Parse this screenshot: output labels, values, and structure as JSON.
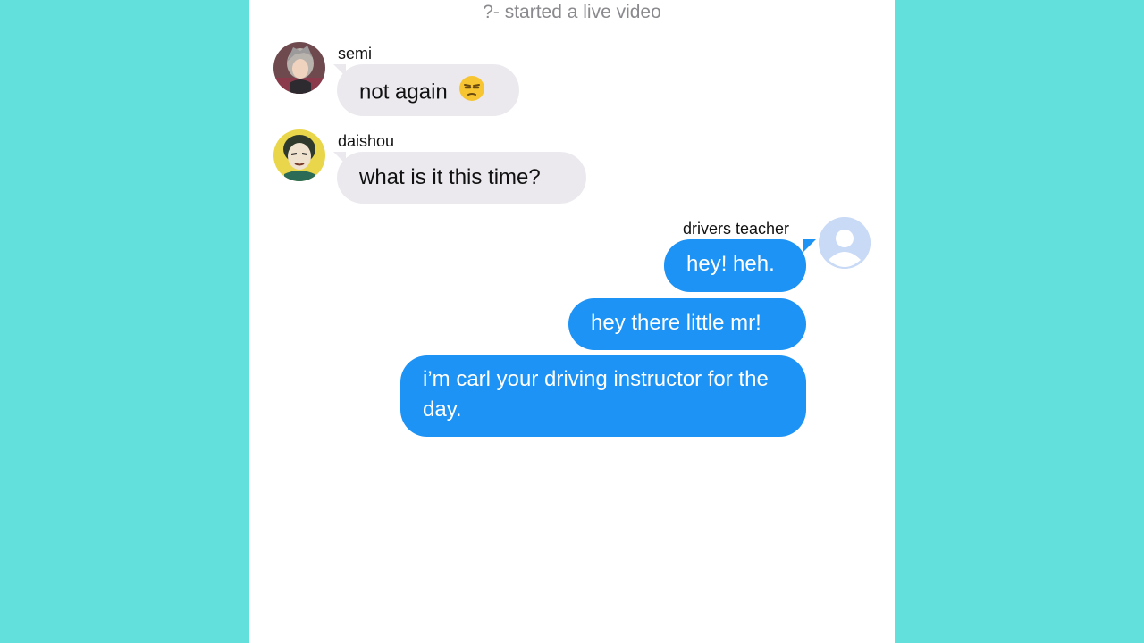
{
  "system_message": "?- started a live video",
  "messages": [
    {
      "sender": "semi",
      "text": "not again",
      "emoji": "unamused-face-icon"
    },
    {
      "sender": "daishou",
      "text": "what is it this time?"
    },
    {
      "sender": "drivers teacher",
      "text": "hey! heh."
    },
    {
      "text": "hey there little mr!"
    },
    {
      "text": "i’m carl your driving instructor for the day."
    }
  ],
  "colors": {
    "background": "#62e1dc",
    "panel": "#ffffff",
    "incoming_bubble": "#ebe9ee",
    "outgoing_bubble": "#1c93f5",
    "system_text": "#8a8a8e"
  }
}
